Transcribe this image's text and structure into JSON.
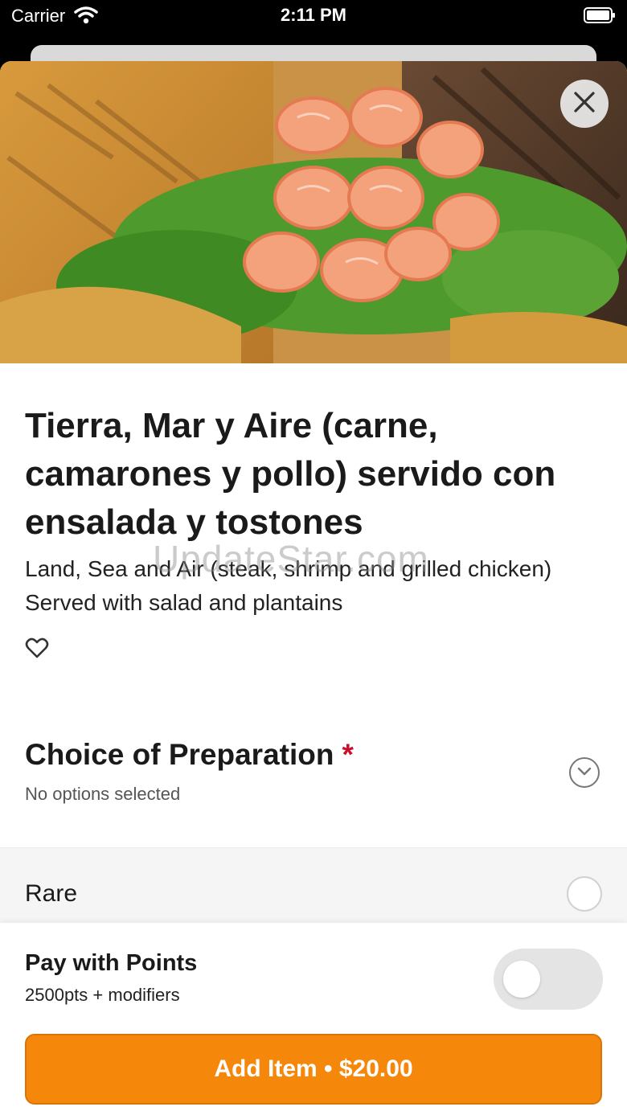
{
  "status_bar": {
    "carrier": "Carrier",
    "time": "2:11 PM"
  },
  "hero_image": {
    "alt_icon": "food-photo",
    "close_icon": "close-icon"
  },
  "item": {
    "title": "Tierra, Mar y Aire (carne, camarones y pollo) servido con ensalada y tostones",
    "description": "Land, Sea and Air (steak, shrimp and grilled chicken) Served with salad and plantains",
    "favorite_icon": "heart-outline-icon"
  },
  "watermark": "UpdateStar.com",
  "modifier_group": {
    "title": "Choice of Preparation",
    "required_marker": "*",
    "status": "No options selected",
    "expand_icon": "chevron-down-icon",
    "options": [
      {
        "label": "Rare",
        "selected": false
      }
    ]
  },
  "points": {
    "title": "Pay with Points",
    "subtitle": "2500pts + modifiers",
    "enabled": false
  },
  "cta": {
    "label": "Add Item • $20.00"
  },
  "colors": {
    "accent": "#f5870a",
    "required": "#c8102e"
  }
}
